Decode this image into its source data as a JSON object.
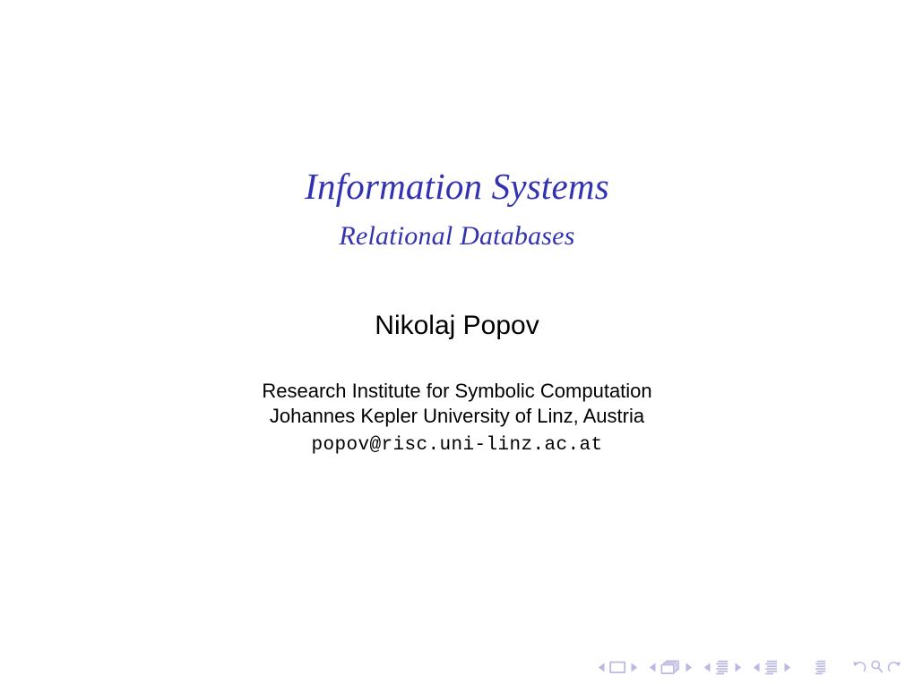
{
  "slide": {
    "title": "Information Systems",
    "subtitle": "Relational Databases",
    "author": "Nikolaj Popov",
    "institute_line_1": "Research Institute for Symbolic Computation",
    "institute_line_2": "Johannes Kepler University of Linz, Austria",
    "email": "popov@risc.uni-linz.ac.at"
  },
  "colors": {
    "title_blue": "#3333b2",
    "body_black": "#000000",
    "background": "#ffffff",
    "nav_symbol": "#b9b9e2"
  },
  "navigation": {
    "groups": [
      {
        "name": "slide-navigation",
        "prev_label": "Previous slide",
        "target_label": "Slide",
        "next_label": "Next slide"
      },
      {
        "name": "frame-navigation",
        "prev_label": "Previous frame",
        "target_label": "Frame",
        "next_label": "Next frame"
      },
      {
        "name": "subsection-navigation",
        "prev_label": "Previous subsection",
        "target_label": "Subsection",
        "next_label": "Next subsection"
      },
      {
        "name": "section-navigation",
        "prev_label": "Previous section",
        "target_label": "Section",
        "next_label": "Next section"
      }
    ],
    "document_label": "Document",
    "back_label": "Back",
    "search_label": "Find",
    "forward_label": "Forward"
  }
}
